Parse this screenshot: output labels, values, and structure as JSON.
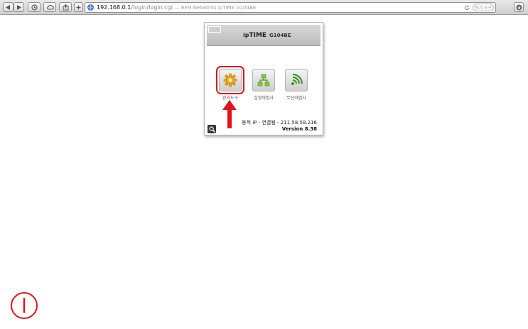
{
  "browser": {
    "url_host": "192.168.0.1",
    "url_path": "/login/login.cgi",
    "url_separator": "—",
    "page_title": "EFM Networks ipTIME G104BE",
    "search_placeholder": "뒤기 도구"
  },
  "router": {
    "brand_prefix": "ip",
    "brand_name": "TIME",
    "model": "G104BE",
    "buttons": [
      {
        "label": "관리도구",
        "icon": "gear-icon"
      },
      {
        "label": "설정마법사",
        "icon": "network-icon"
      },
      {
        "label": "무선마법사",
        "icon": "wifi-icon"
      }
    ],
    "status_text": "동적 IP - 연결됨 - 211.58.58.216",
    "version_text": "Version 8.38"
  },
  "annotations": {
    "highlight_color": "#e0141b"
  }
}
